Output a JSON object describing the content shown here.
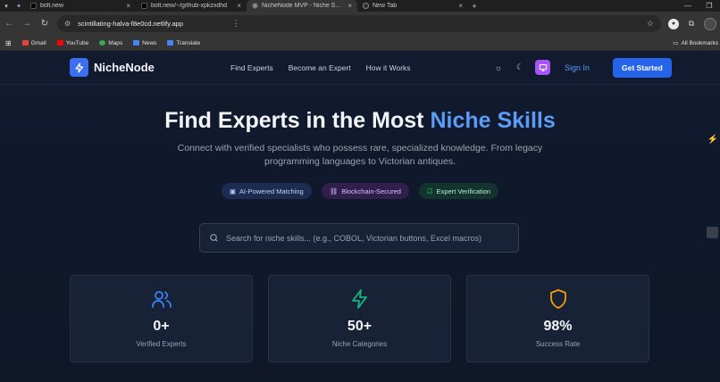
{
  "browser": {
    "tabs": [
      {
        "title": "bolt.new",
        "active": false
      },
      {
        "title": "bolt.new/~/github-xpkzxdhd",
        "active": false
      },
      {
        "title": "NicheNode MVP - Niche Skills",
        "active": true
      },
      {
        "title": "New Tab",
        "active": false
      }
    ],
    "url": "scintillating-halva-f8e0cd.netlify.app",
    "bookmarks": [
      "Gmail",
      "YouTube",
      "Maps",
      "News",
      "Translate"
    ],
    "all_bookmarks": "All Bookmarks"
  },
  "site": {
    "brand": "NicheNode",
    "nav": [
      "Find Experts",
      "Become an Expert",
      "How it Works"
    ],
    "sign_in": "Sign In",
    "get_started": "Get Started",
    "hero": {
      "title_main": "Find Experts in the Most ",
      "title_highlight": "Niche Skills",
      "subtitle": "Connect with verified specialists who possess rare, specialized knowledge. From legacy programming languages to Victorian antiques."
    },
    "badges": [
      {
        "label": "AI-Powered Matching",
        "icon": "robot-icon"
      },
      {
        "label": "Blockchain-Secured",
        "icon": "link-icon"
      },
      {
        "label": "Expert Verification",
        "icon": "checkbox-icon"
      }
    ],
    "search": {
      "placeholder": "Search for niche skills... (e.g., COBOL, Victorian buttons, Excel macros)"
    },
    "stats": [
      {
        "value": "0+",
        "label": "Verified Experts",
        "icon": "users-icon",
        "color": "#3b82f6"
      },
      {
        "value": "50+",
        "label": "Niche Categories",
        "icon": "lightning-icon",
        "color": "#10b981"
      },
      {
        "value": "98%",
        "label": "Success Rate",
        "icon": "shield-icon",
        "color": "#f59e0b"
      }
    ]
  },
  "colors": {
    "accent": "#2563eb",
    "highlight": "#5b9cf6",
    "purple": "#a855f7",
    "bg": "#0f1729"
  }
}
